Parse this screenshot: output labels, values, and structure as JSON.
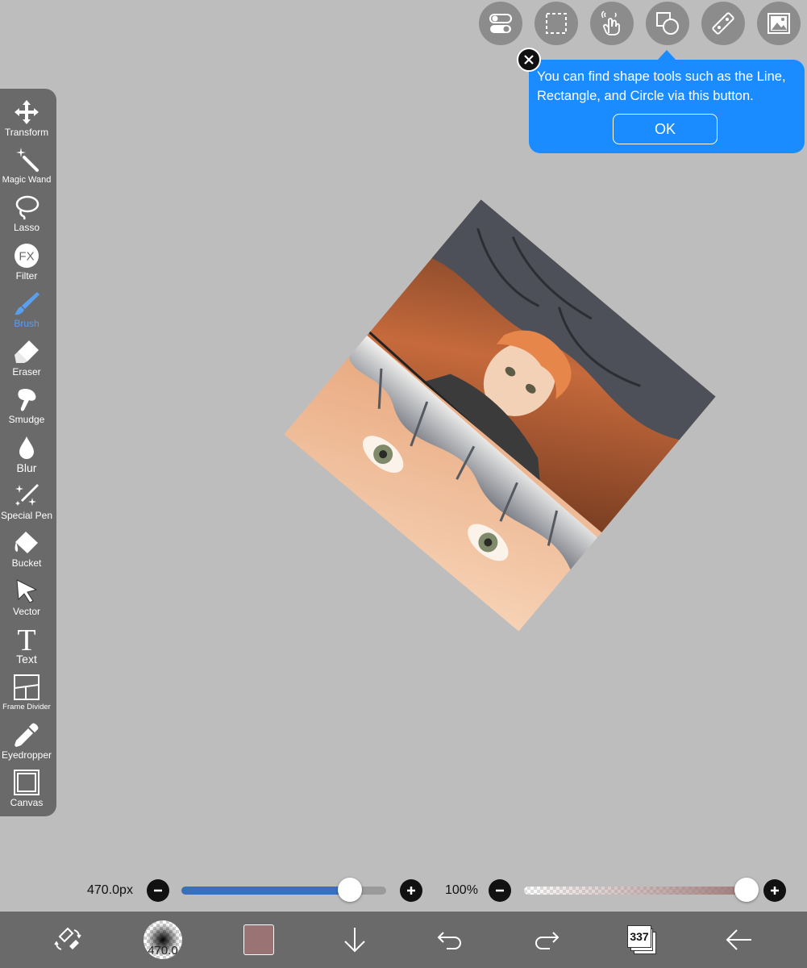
{
  "top_toolbar": {
    "buttons": [
      {
        "name": "toggle-icon"
      },
      {
        "name": "selection-icon"
      },
      {
        "name": "gesture-icon"
      },
      {
        "name": "shapes-icon"
      },
      {
        "name": "ruler-icon"
      },
      {
        "name": "image-icon"
      }
    ]
  },
  "tooltip": {
    "text": "You can find shape tools such as the Line, Rectangle, and Circle via this button.",
    "ok_label": "OK"
  },
  "tools": [
    {
      "label": "Transform",
      "icon": "move-arrows-icon"
    },
    {
      "label": "Magic Wand",
      "icon": "magic-wand-icon"
    },
    {
      "label": "Lasso",
      "icon": "lasso-icon"
    },
    {
      "label": "Filter",
      "icon": "fx-icon"
    },
    {
      "label": "Brush",
      "icon": "brush-icon",
      "active": true
    },
    {
      "label": "Eraser",
      "icon": "eraser-icon"
    },
    {
      "label": "Smudge",
      "icon": "smudge-icon"
    },
    {
      "label": "Blur",
      "icon": "droplet-icon"
    },
    {
      "label": "Special Pen",
      "icon": "sparkle-pen-icon"
    },
    {
      "label": "Bucket",
      "icon": "bucket-icon"
    },
    {
      "label": "Vector",
      "icon": "cursor-arrow-icon"
    },
    {
      "label": "Text",
      "icon": "text-icon"
    },
    {
      "label": "Frame Divider",
      "icon": "frame-divider-icon"
    },
    {
      "label": "Eyedropper",
      "icon": "eyedropper-icon"
    },
    {
      "label": "Canvas",
      "icon": "canvas-icon"
    }
  ],
  "brush_size": {
    "label": "470.0px",
    "value_fraction": 0.88
  },
  "opacity": {
    "label": "100%",
    "value_fraction": 1.0
  },
  "bottom_bar": {
    "brush_preview_label": "470.0",
    "color": "#9a7474",
    "layers_count": "337"
  },
  "colors": {
    "accent": "#1a8cff",
    "active_tool": "#5a9ef0",
    "panel": "#6a6a6a",
    "canvas_bg": "#bdbdbd"
  }
}
